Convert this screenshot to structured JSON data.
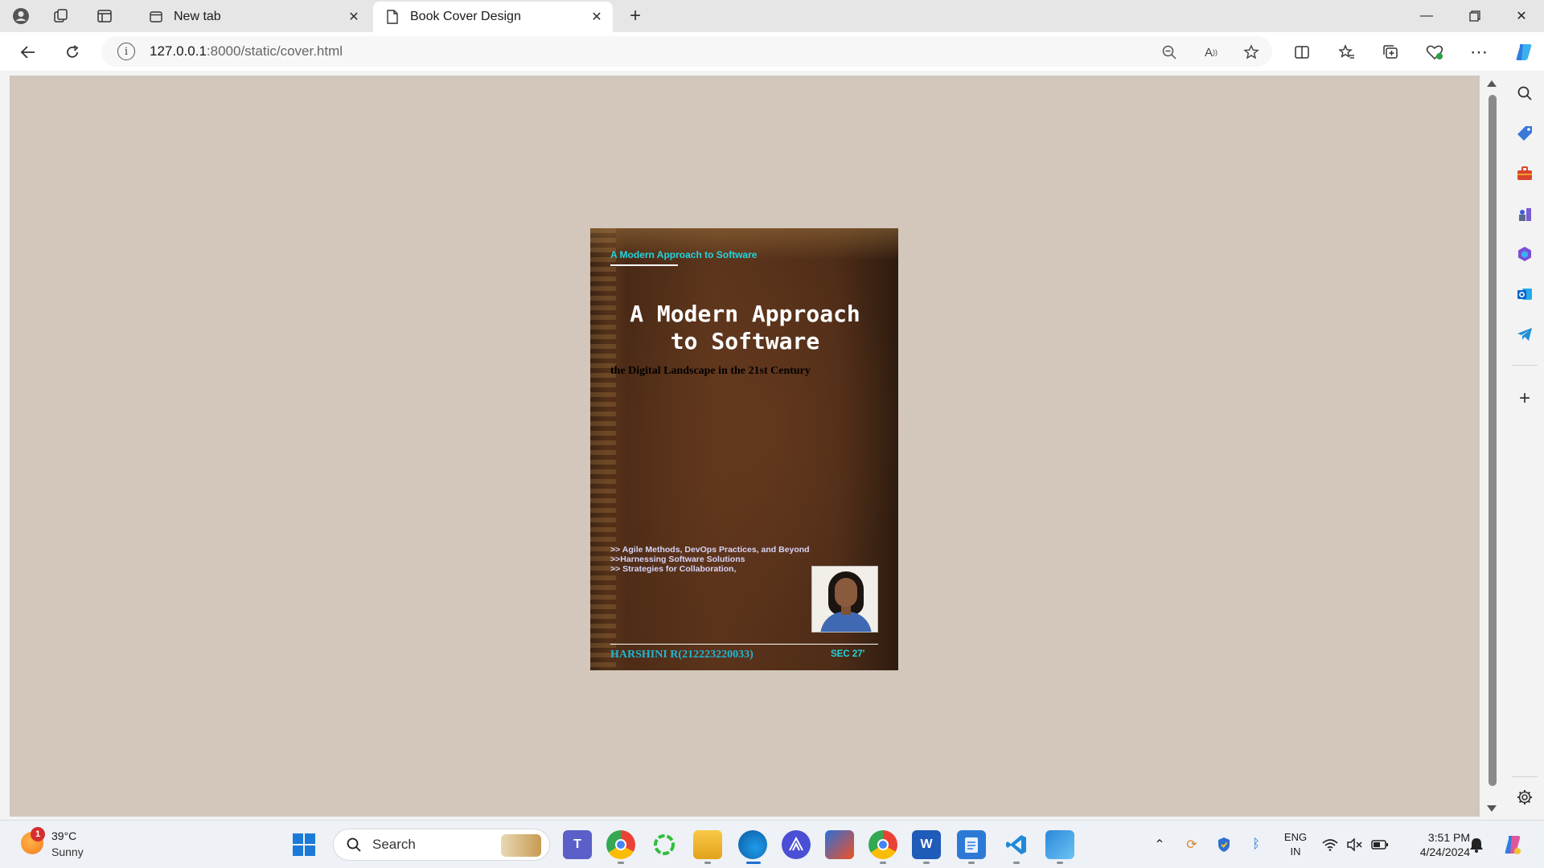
{
  "browser": {
    "tabs": [
      {
        "label": "New tab",
        "active": false
      },
      {
        "label": "Book Cover Design",
        "active": true
      }
    ],
    "address": {
      "host": "127.0.0.1",
      "path": ":8000/static/cover.html"
    }
  },
  "cover": {
    "header_small": "A Modern Approach to Software",
    "title_line1": "A Modern Approach",
    "title_line2": "to Software",
    "subtitle": "the Digital Landscape in the 21st Century",
    "bullets": [
      ">> Agile Methods, DevOps Practices, and Beyond",
      ">>Harnessing Software Solutions",
      ">> Strategies for Collaboration,"
    ],
    "author": "HARSHINI R(212223220033)",
    "section": "SEC 27'",
    "colors": {
      "accent_cyan": "#20d6e0",
      "author_blue": "#22b6d6",
      "page_background": "#d3c7bb"
    }
  },
  "taskbar": {
    "weather_temp": "39°C",
    "weather_condition": "Sunny",
    "weather_badge": "1",
    "search_label": "Search",
    "language_line1": "ENG",
    "language_line2": "IN",
    "time": "3:51 PM",
    "date": "4/24/2024"
  },
  "icons": {
    "titlebar": [
      "profile-icon",
      "workspaces-icon",
      "tab-actions-icon"
    ],
    "toolbar": [
      "back-icon",
      "refresh-icon",
      "info-icon",
      "zoom-out-icon",
      "read-aloud-icon",
      "favorite-star-icon",
      "split-screen-icon",
      "favorites-icon",
      "collections-icon",
      "browser-essentials-icon",
      "more-icon",
      "copilot-icon"
    ],
    "sidebar": [
      "search-icon",
      "shopping-tag-icon",
      "tools-icon",
      "games-icon",
      "microsoft365-icon",
      "outlook-icon",
      "telegram-icon",
      "add-icon",
      "settings-icon"
    ]
  }
}
